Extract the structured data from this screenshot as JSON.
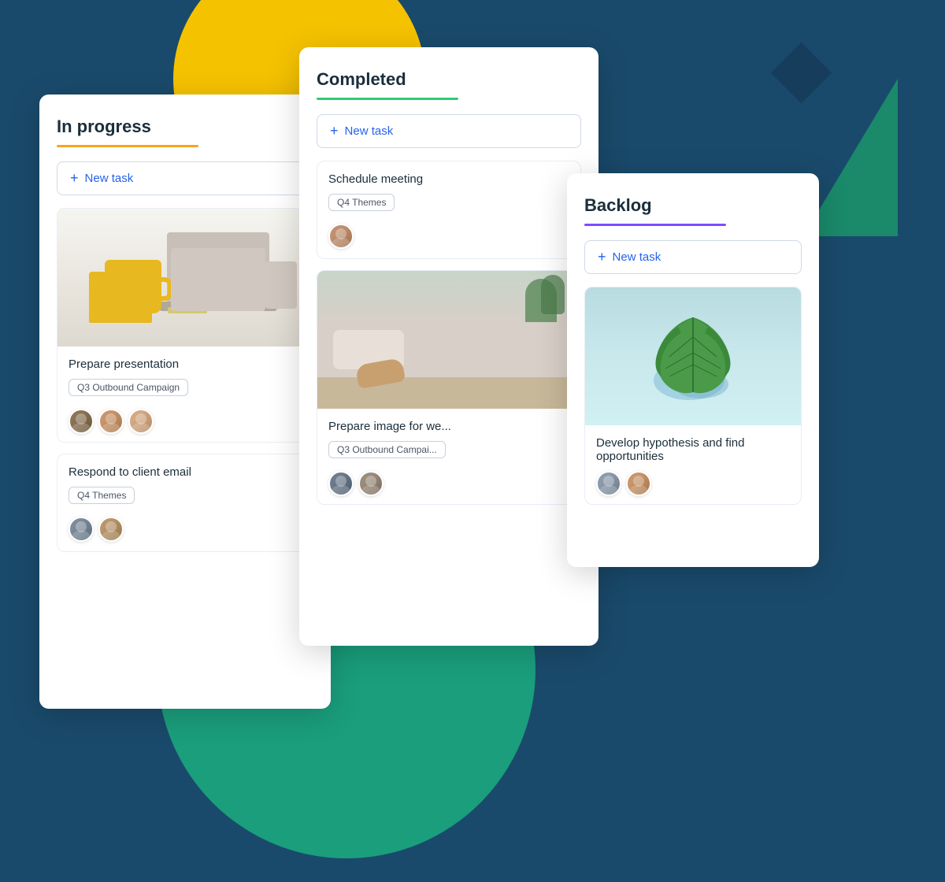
{
  "background": {
    "color": "#1a4a6b"
  },
  "columns": {
    "inprogress": {
      "title": "In progress",
      "underline_color": "#f5a623",
      "new_task_label": "New task",
      "tasks": [
        {
          "id": "task-1",
          "has_image": true,
          "title": "Prepare presentation",
          "tag": "Q3 Outbound Campaign",
          "avatars": [
            "man1",
            "woman1",
            "woman2"
          ]
        },
        {
          "id": "task-2",
          "has_image": false,
          "title": "Respond to client email",
          "tag": "Q4 Themes",
          "avatars": [
            "man2",
            "woman3"
          ]
        }
      ]
    },
    "completed": {
      "title": "Completed",
      "underline_color": "#2ecc71",
      "new_task_label": "New task",
      "tasks": [
        {
          "id": "task-3",
          "has_image": false,
          "title": "Schedule meeting",
          "tag": "Q4 Themes",
          "avatars": [
            "woman4"
          ]
        },
        {
          "id": "task-4",
          "has_image": true,
          "title": "Prepare image for we...",
          "tag": "Q3 Outbound Campai...",
          "avatars": [
            "man3",
            "man4"
          ]
        }
      ]
    },
    "backlog": {
      "title": "Backlog",
      "underline_color": "#7c4dff",
      "new_task_label": "New task",
      "tasks": [
        {
          "id": "task-5",
          "has_image": true,
          "title": "Develop hypothesis and find opportunities",
          "tag": "",
          "avatars": [
            "man5",
            "woman1"
          ]
        }
      ]
    }
  }
}
